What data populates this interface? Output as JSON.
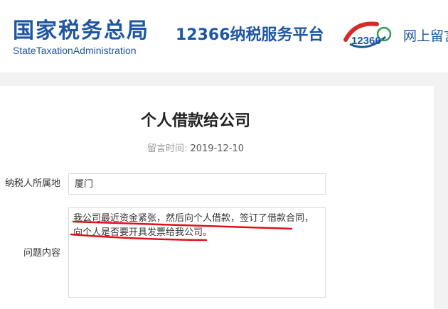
{
  "header": {
    "logo_cn": "国家税务总局",
    "logo_en": "StateTaxationAdministration",
    "platform": "12366纳税服务平台",
    "badge_digits": "12366",
    "message_link": "网上留言"
  },
  "post": {
    "title": "个人借款给公司",
    "date_label": "留言时间:",
    "date_value": "2019-12-10",
    "location_label": "纳税人所属地",
    "location_value": "厦门",
    "question_label": "问题内容",
    "question_line1": "我公司最近资金紧张，然后向个人借款，签订了借款合同，",
    "question_line2": "向个人是否要开具发票给我公司。"
  },
  "colors": {
    "brand": "#1e56a3",
    "annotation": "#e0101a"
  }
}
